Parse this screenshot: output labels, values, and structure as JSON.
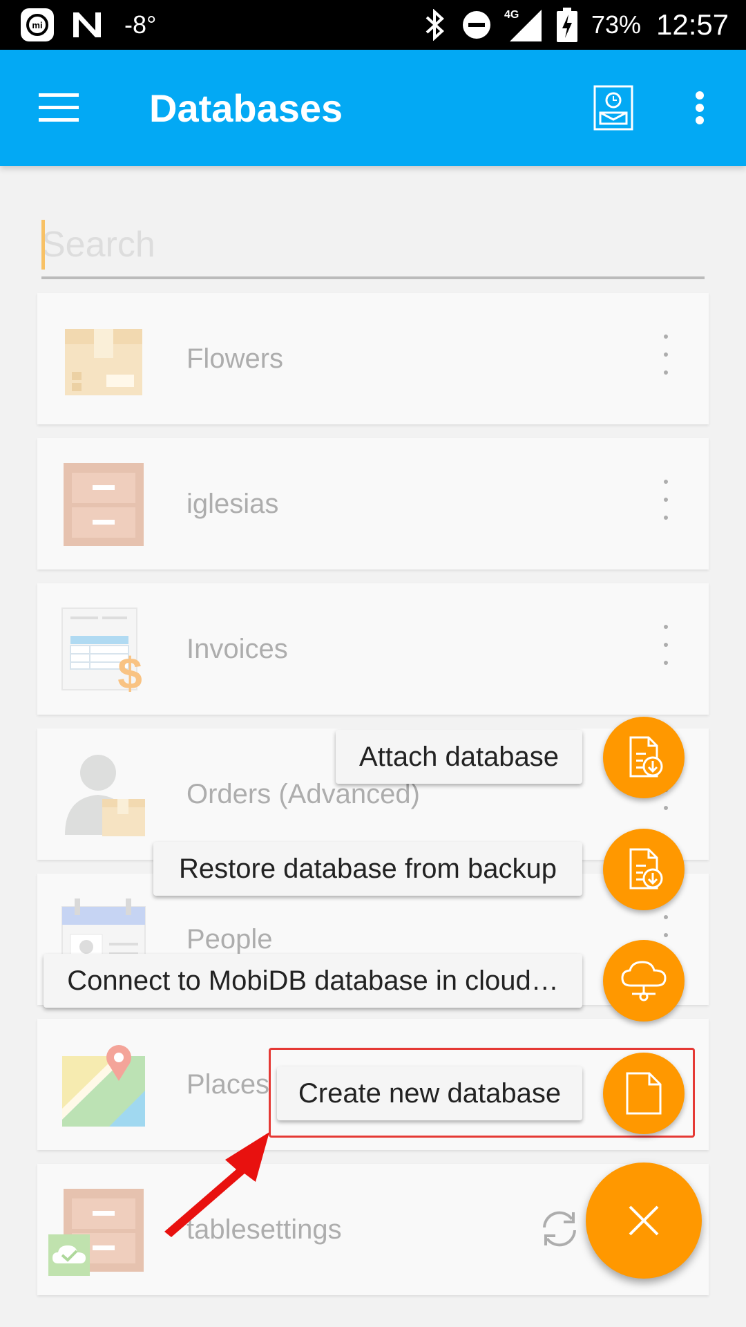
{
  "status_bar": {
    "temperature": "-8°",
    "network": "4G",
    "battery": "73%",
    "time": "12:57",
    "icons": [
      "mi-icon",
      "n-icon",
      "bluetooth-icon",
      "dnd-icon",
      "signal-icon",
      "battery-icon"
    ]
  },
  "app_bar": {
    "title": "Databases",
    "menu_icon": "hamburger-icon",
    "action_icon": "id-badge-icon",
    "overflow_icon": "more-vert-icon"
  },
  "search": {
    "placeholder": "Search",
    "value": ""
  },
  "databases": [
    {
      "name": "Flowers",
      "icon": "box-icon"
    },
    {
      "name": "iglesias",
      "icon": "cabinet-icon"
    },
    {
      "name": "Invoices",
      "icon": "invoice-icon"
    },
    {
      "name": "Orders (Advanced)",
      "icon": "person-box-icon"
    },
    {
      "name": "People",
      "icon": "contact-card-icon"
    },
    {
      "name": "Places",
      "icon": "map-icon"
    },
    {
      "name": "tablesettings",
      "icon": "cabinet-cloud-icon"
    }
  ],
  "speed_dial": {
    "actions": [
      {
        "label": "Attach database",
        "icon": "attach-file-icon"
      },
      {
        "label": "Restore database from backup",
        "icon": "restore-file-icon"
      },
      {
        "label": "Connect to MobiDB database in cloud…",
        "icon": "cloud-icon"
      },
      {
        "label": "Create new database",
        "icon": "new-file-icon"
      }
    ],
    "close_icon": "close-icon"
  },
  "colors": {
    "app_bar": "#03a9f4",
    "fab": "#ff9800",
    "highlight": "#e53935"
  }
}
